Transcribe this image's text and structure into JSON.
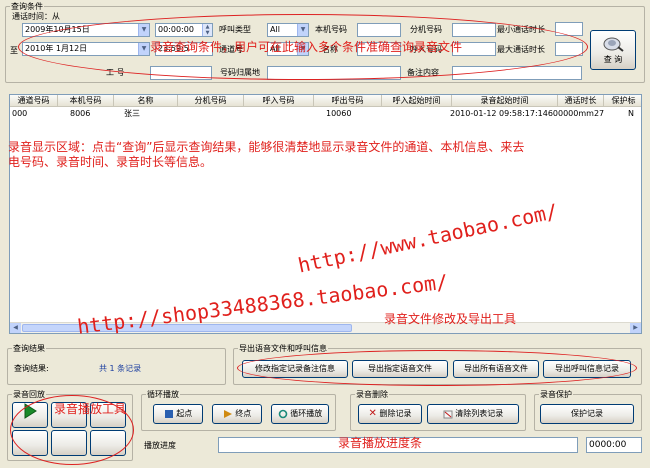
{
  "query": {
    "group_title": "查询条件",
    "call_time_label": "通话时间：从",
    "to_label": "至",
    "start_date": "2009年10月15日",
    "start_time": "00:00:00",
    "end_date": "2010年 1月12日",
    "end_time_partial": "23:59:5",
    "call_type_label": "呼叫类型",
    "call_type_value": "All",
    "channel_label": "通道号",
    "channel_value": "All",
    "local_number_label": "本机号码",
    "name_label": "名称",
    "ext_label": "分机号码",
    "caller_label": "呼入号码",
    "min_duration_label": "最小通话时长",
    "max_duration_label": "最大通话时长",
    "worker_label": "工  号",
    "location_label": "号码归属地",
    "remark_label": "备注内容",
    "search_button": "查 询"
  },
  "table": {
    "columns": [
      "通道号码",
      "本机号码",
      "名称",
      "分机号码",
      "呼入号码",
      "呼出号码",
      "呼入起始时间",
      "录音起始时间",
      "通话时长",
      "保护标"
    ],
    "rows": [
      [
        "000",
        "8006",
        "张三",
        "",
        "",
        "10060",
        "",
        "2010-01-12 09:58:17:146000",
        "0000mm27ss",
        "N"
      ]
    ]
  },
  "results": {
    "group_title": "查询结果",
    "label": "查询结果:",
    "value": "共 1 条记录"
  },
  "export": {
    "group_title": "导出语音文件和呼叫信息",
    "btn_edit_remark": "修改指定记录备注信息",
    "btn_export_selected": "导出指定语音文件",
    "btn_export_all": "导出所有语音文件",
    "btn_export_call_info": "导出呼叫信息记录"
  },
  "playback": {
    "group_title": "录音回放",
    "loop_group_title": "循环播放",
    "btn_start": "起点",
    "btn_end": "终点",
    "btn_loop": "循环播放",
    "delete_group_title": "录音删除",
    "btn_delete": "删除记录",
    "btn_clear": "清除列表记录",
    "protect_group_title": "录音保护",
    "btn_protect": "保护记录",
    "progress_label": "播放进度",
    "progress_time": "0000:00"
  },
  "annotations": {
    "query_note": "录音查询条件，用户可在此输入多个条件准确查询录音文件",
    "display_note_1": "录音显示区域：点击“查询”后显示查询结果，能够很清楚地显示录音文件的通道、本机信息、来去",
    "display_note_2": "电号码、录音时间、录音时长等信息。",
    "url_1": "http://www.taobao.com/",
    "url_2": "http://shop33488368.taobao.com/",
    "export_note": "录音文件修改及导出工具",
    "playback_note": "录音播放工具",
    "progress_note": "录音播放进度条"
  },
  "colors": {
    "annotation": "#e0201c",
    "window_bg": "#ece9d8",
    "blue_text": "#1c3fa0"
  }
}
